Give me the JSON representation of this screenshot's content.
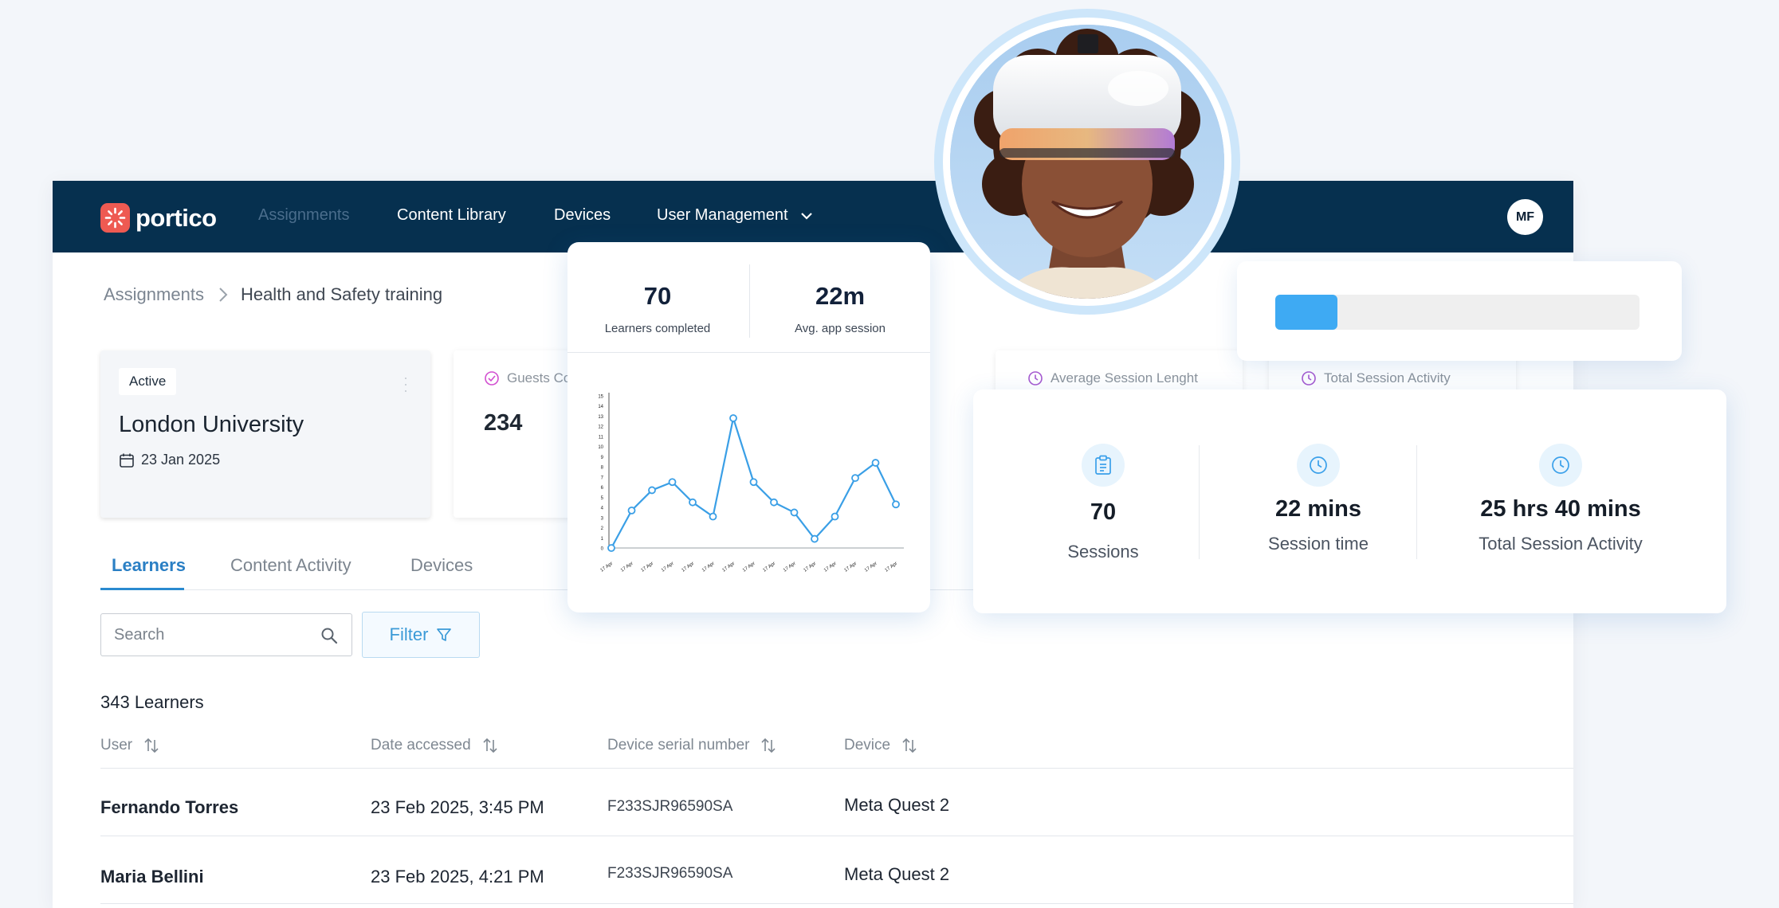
{
  "nav": {
    "brand": "portico",
    "items": [
      "Assignments",
      "Content Library",
      "Devices",
      "User Management"
    ],
    "avatar_initials": "MF"
  },
  "breadcrumb": {
    "root": "Assignments",
    "current": "Health and Safety training"
  },
  "uni_card": {
    "status": "Active",
    "title": "London University",
    "date": "23 Jan 2025"
  },
  "stat_cards": [
    {
      "label": "Guests Co",
      "value": "234"
    },
    {
      "label": "Average Session Lenght",
      "value": ""
    },
    {
      "label": "Total Session Activity",
      "value": ""
    }
  ],
  "tabs": [
    "Learners",
    "Content Activity",
    "Devices"
  ],
  "search": {
    "placeholder": "Search"
  },
  "filter_label": "Filter",
  "learner_count": "343 Learners",
  "table": {
    "headers": [
      "User",
      "Date accessed",
      "Device serial number",
      "Device"
    ],
    "rows": [
      {
        "user": "Fernando Torres",
        "date": "23 Feb 2025, 3:45 PM",
        "serial": "F233SJR96590SA",
        "device": "Meta Quest 2"
      },
      {
        "user": "Maria Bellini",
        "date": "23 Feb 2025, 4:21 PM",
        "serial": "F233SJR96590SA",
        "device": "Meta Quest 2"
      }
    ]
  },
  "chart_card": {
    "learners_completed": "70",
    "learners_completed_label": "Learners completed",
    "avg_session": "22m",
    "avg_session_label": "Avg. app session"
  },
  "chart_data": {
    "type": "line",
    "x": [
      "17 Apr",
      "17 Apr",
      "17 Apr",
      "17 Apr",
      "17 Apr",
      "17 Apr",
      "17 Apr",
      "17 Apr",
      "17 Apr",
      "17 Apr",
      "17 Apr",
      "17 Apr",
      "17 Apr",
      "17 Apr",
      "17 Apr"
    ],
    "values": [
      0,
      3.7,
      5.7,
      6.5,
      4.5,
      3.1,
      12.8,
      6.5,
      4.5,
      3.5,
      0.9,
      3.1,
      6.9,
      8.4,
      4.3
    ],
    "ylim": [
      0,
      15
    ],
    "yticks": [
      0,
      1,
      2,
      3,
      4,
      5,
      6,
      7,
      8,
      9,
      10,
      11,
      12,
      13,
      14,
      15
    ],
    "color": "#3a9fe6"
  },
  "progress": {
    "value": 0.17,
    "color": "#3eaaf3"
  },
  "sessions_card": [
    {
      "icon": "clipboard-icon",
      "value": "70",
      "label": "Sessions"
    },
    {
      "icon": "clock-icon",
      "value": "22 mins",
      "label": "Session time"
    },
    {
      "icon": "clock-icon",
      "value": "25 hrs 40 mins",
      "label": "Total Session Activity"
    }
  ]
}
